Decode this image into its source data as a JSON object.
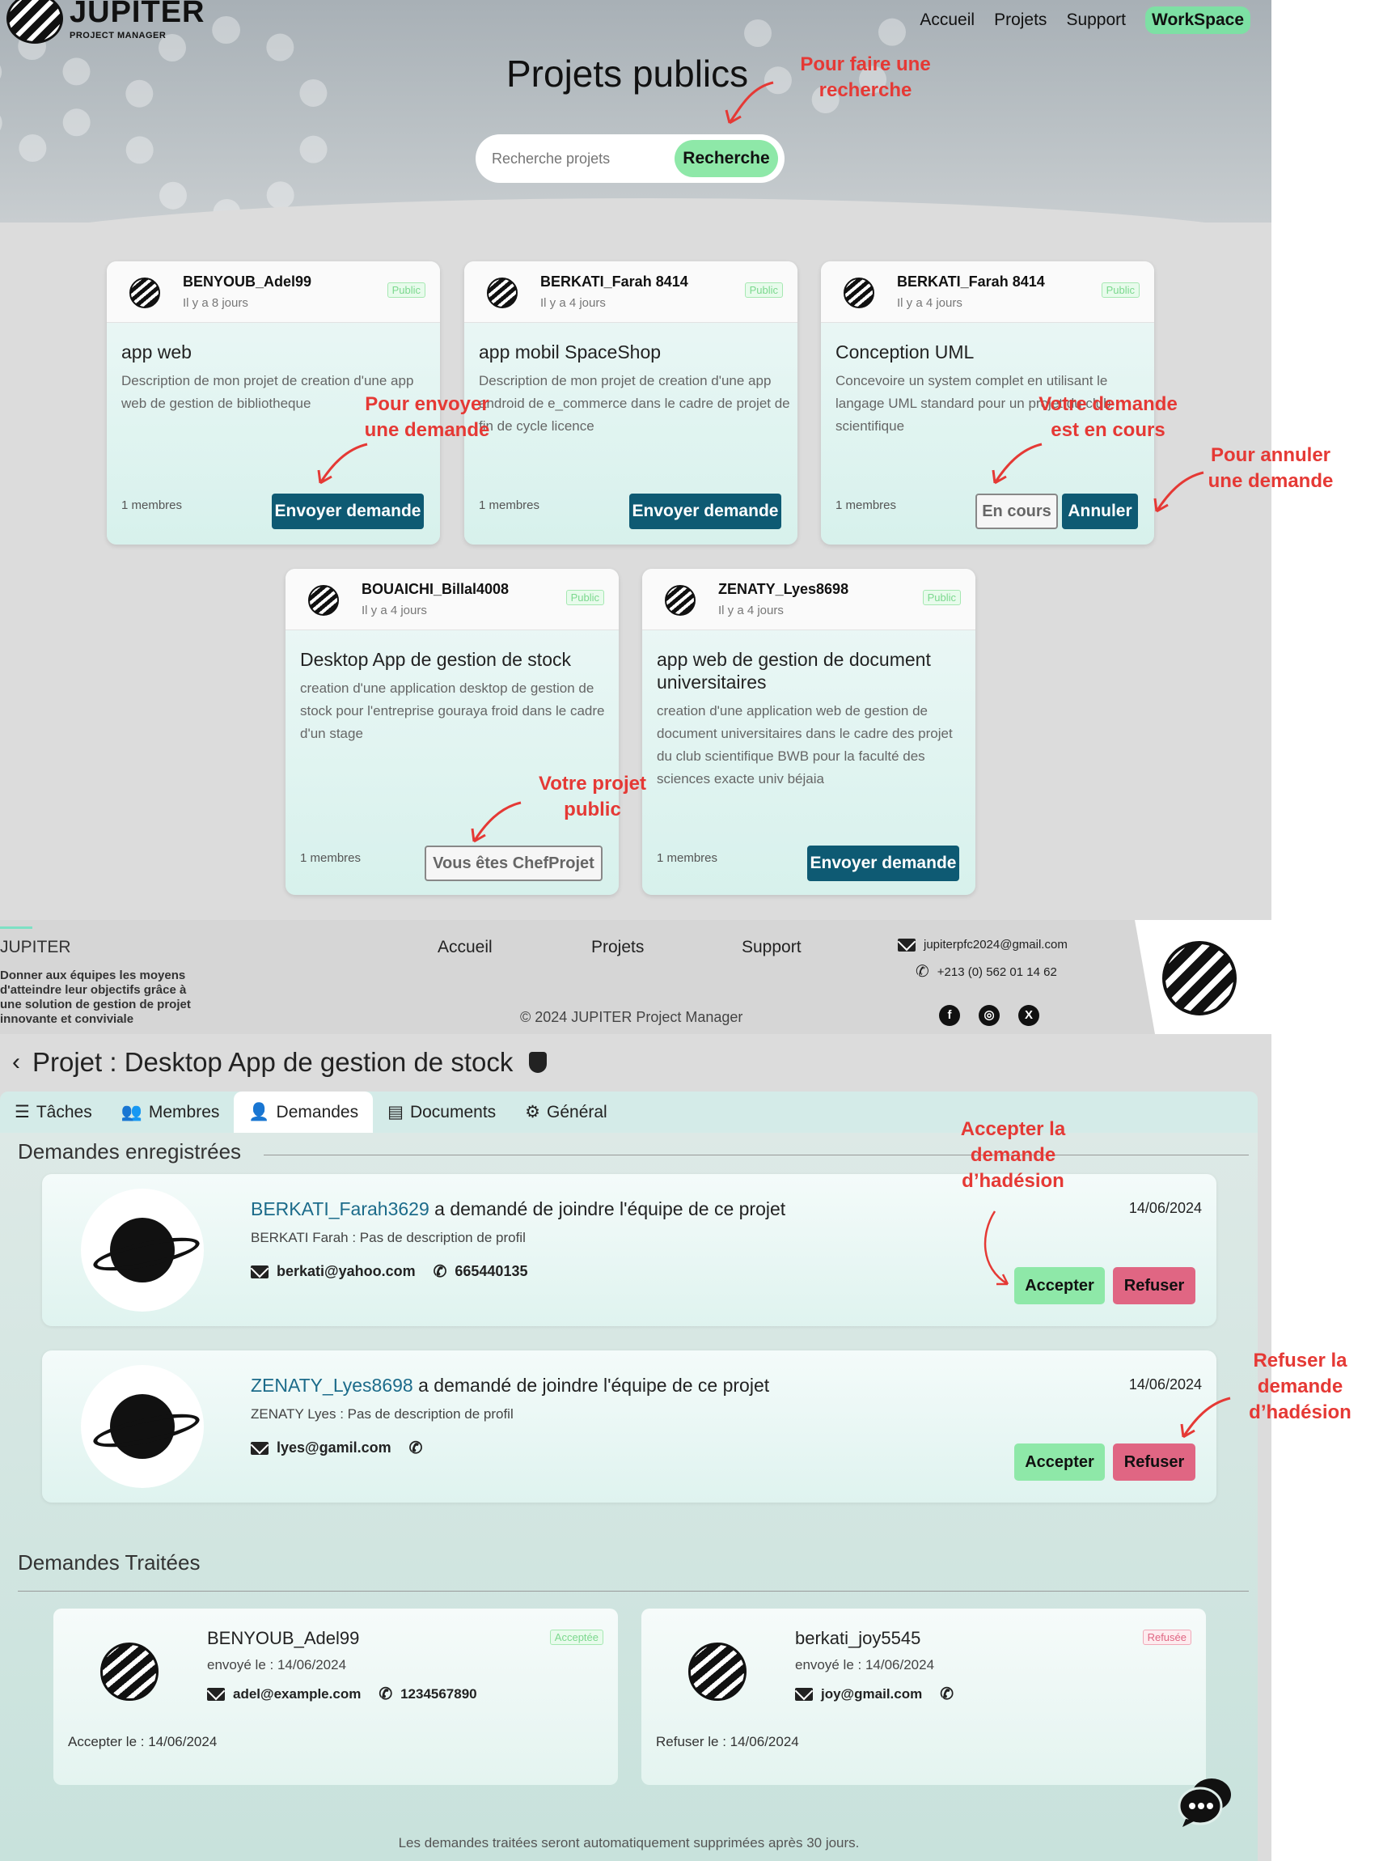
{
  "brand": {
    "name": "JUPITER",
    "sub": "PROJECT MANAGER"
  },
  "nav": {
    "items": [
      "Accueil",
      "Projets",
      "Support"
    ],
    "workspace": "WorkSpace"
  },
  "hero": {
    "title": "Projets publics",
    "search_placeholder": "Recherche projets",
    "search_button": "Recherche"
  },
  "cards": [
    {
      "owner": "BENYOUB_Adel99",
      "ago": "Il y a 8 jours",
      "badge": "Public",
      "title": "app web",
      "desc": "Description de mon projet de creation d'une app web de gestion de bibliotheque",
      "members": "1 membres",
      "action": "Envoyer demande"
    },
    {
      "owner": "BERKATI_Farah 8414",
      "ago": "Il y a 4 jours",
      "badge": "Public",
      "title": "app mobil SpaceShop",
      "desc": "Description de mon projet de creation d'une app android de e_commerce dans le cadre de projet de fin de cycle licence",
      "members": "1 membres",
      "action": "Envoyer demande"
    },
    {
      "owner": "BERKATI_Farah 8414",
      "ago": "Il y a 4 jours",
      "badge": "Public",
      "title": "Conception UML",
      "desc": "Concevoire un system complet en utilisant le langage UML standard pour un projet du club scientifique",
      "members": "1 membres",
      "status": "En cours",
      "cancel": "Annuler"
    },
    {
      "owner": "BOUAICHI_Billal4008",
      "ago": "Il y a 4 jours",
      "badge": "Public",
      "title": "Desktop App de gestion de stock",
      "desc": "creation d'une application desktop de gestion de stock pour l'entreprise gouraya froid dans le cadre d'un stage",
      "members": "1 membres",
      "status": "Vous êtes ChefProjet"
    },
    {
      "owner": "ZENATY_Lyes8698",
      "ago": "Il y a 4 jours",
      "badge": "Public",
      "title": "app web de gestion de document universitaires",
      "desc": "creation d'une application web de gestion de document universitaires dans le cadre des projet du club scientifique BWB pour la faculté des sciences exacte univ béjaia",
      "members": "1 membres",
      "action": "Envoyer demande"
    }
  ],
  "annotations": {
    "search": "Pour faire une recherche",
    "send": "Pour envoyer une demande",
    "pending": "Votre demande est en cours",
    "cancel": "Pour annuler une demande",
    "public": "Votre projet public",
    "accept": "Accepter la demande d’hadésion",
    "refuse": "Refuser la demande d’hadésion"
  },
  "footer": {
    "brand": "JUPITER",
    "desc": "Donner aux équipes les moyens d'atteindre leur objectifs grâce à une solution de gestion de projet innovante et conviviale",
    "links": [
      "Accueil",
      "Projets",
      "Support"
    ],
    "email": "jupiterpfc2024@gmail.com",
    "phone": "+213 (0) 562 01 14 62",
    "copyright": "© 2024 JUPITER Project Manager"
  },
  "project": {
    "title": "Projet : Desktop App de gestion de stock"
  },
  "tabs": [
    {
      "label": "Tâches",
      "icon": "list-icon"
    },
    {
      "label": "Membres",
      "icon": "users-icon"
    },
    {
      "label": "Demandes",
      "icon": "user-plus-icon"
    },
    {
      "label": "Documents",
      "icon": "file-icon"
    },
    {
      "label": "Général",
      "icon": "gear-icon"
    }
  ],
  "pending_section": {
    "title": "Demandes enregistrées"
  },
  "requests": [
    {
      "user": "BERKATI_Farah3629",
      "text": " a demandé de joindre l'équipe de ce projet",
      "profile": "BERKATI Farah : Pas de description de profil",
      "email": "berkati@yahoo.com",
      "phone": "665440135",
      "date": "14/06/2024",
      "accept": "Accepter",
      "refuse": "Refuser"
    },
    {
      "user": "ZENATY_Lyes8698",
      "text": " a demandé de joindre l'équipe de ce projet",
      "profile": "ZENATY Lyes : Pas de description de profil",
      "email": "lyes@gamil.com",
      "phone": "",
      "date": "14/06/2024",
      "accept": "Accepter",
      "refuse": "Refuser"
    }
  ],
  "processed_section": {
    "title": "Demandes Traitées"
  },
  "processed": [
    {
      "user": "BENYOUB_Adel99",
      "sent": "envoyé le : 14/06/2024",
      "email": "adel@example.com",
      "phone": "1234567890",
      "status": "Acceptée",
      "result": "Accepter le : 14/06/2024"
    },
    {
      "user": "berkati_joy5545",
      "sent": "envoyé le : 14/06/2024",
      "email": "joy@gmail.com",
      "phone": "",
      "status": "Refusée",
      "result": "Refuser le : 14/06/2024"
    }
  ],
  "note": "Les demandes traitées seront automatiquement supprimées après 30 jours.",
  "colors": {
    "accent": "#0e5a73",
    "green": "#8ee8a8",
    "red": "#e06683",
    "annotation": "#e53935"
  }
}
